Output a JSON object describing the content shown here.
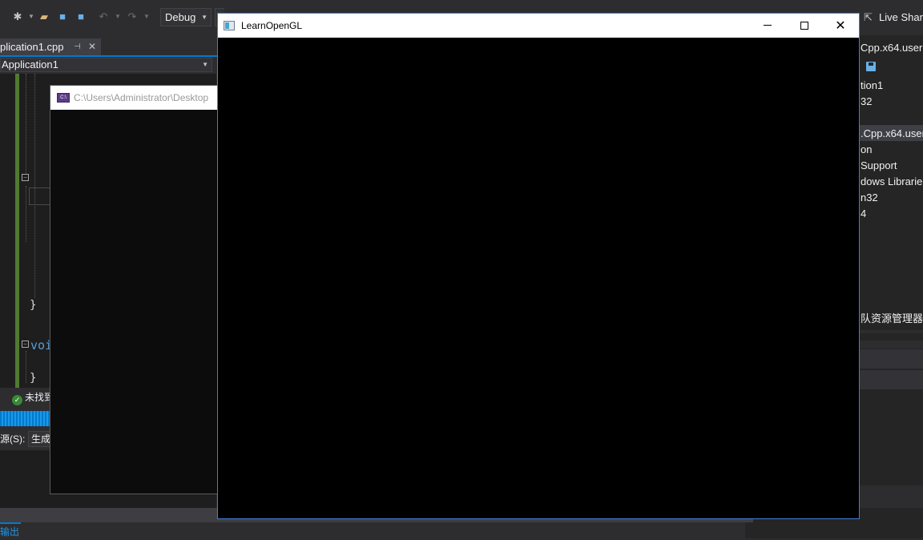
{
  "toolbar": {
    "config": "Debug",
    "live_share": "Live Shar",
    "icons": [
      "new-project-icon",
      "open-folder-icon",
      "save-icon",
      "save-all-icon",
      "undo-icon",
      "redo-icon"
    ]
  },
  "editor": {
    "doc_tab": "plication1.cpp",
    "nav_scope": "Application1",
    "code_keyword": "voi",
    "find_status": "未找到",
    "output_source_label": "源(S):",
    "output_source_value": "生成",
    "output_tab": "输出"
  },
  "console": {
    "title": "C:\\Users\\Administrator\\Desktop",
    "icon_text": "C:\\"
  },
  "right_panel": {
    "items": [
      "Cpp.x64.user",
      "tion1",
      "32",
      ".Cpp.x64.user",
      "on",
      "Support",
      "dows Librarie",
      "n32",
      "4",
      "队资源管理器"
    ]
  },
  "gl_window": {
    "title": "LearnOpenGL",
    "canvas_color": "#000000",
    "border_color": "#3c7fd6"
  },
  "colors": {
    "accent": "#007acc",
    "ide_background": "#2d2d30",
    "editor_background": "#1e1e1e",
    "change_bar": "#4f7a32",
    "keyword": "#569cd6"
  }
}
